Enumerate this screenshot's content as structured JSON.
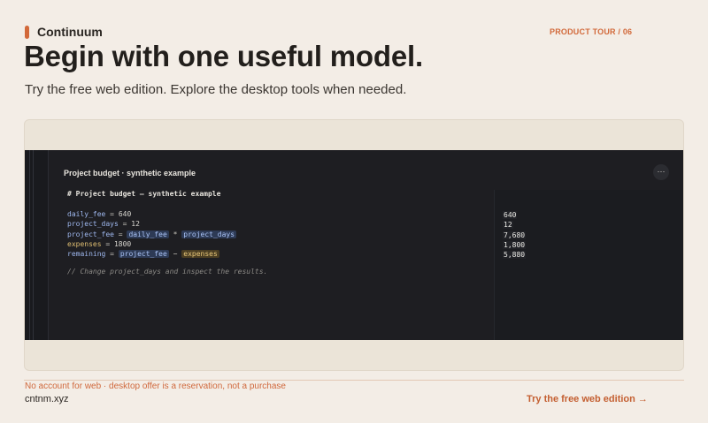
{
  "brand": {
    "name": "Continuum",
    "accent": "#d2693a"
  },
  "tour_label": "PRODUCT TOUR / 06",
  "headline": "Begin with one useful model.",
  "subhead": "Try the free web edition. Explore the desktop tools when needed.",
  "editor": {
    "title": "Project budget · synthetic example",
    "menu_label": "···",
    "heading": "# Project budget — synthetic example",
    "lines": [
      {
        "name": "daily_fee",
        "op": " = ",
        "value": "640"
      },
      {
        "name": "project_days",
        "op": " = ",
        "value": "12"
      },
      {
        "name": "project_fee",
        "op": " = ",
        "a": "daily_fee",
        "op2": " * ",
        "b": "project_days"
      },
      {
        "name": "expenses",
        "op": " = ",
        "value": "1800"
      },
      {
        "name": "remaining",
        "op": " = ",
        "a": "project_fee",
        "op2": " − ",
        "b": "expenses"
      }
    ],
    "comment": "// Change project_days and inspect the results.",
    "results": [
      "640",
      "12",
      "7,680",
      "1,800",
      "5,880"
    ]
  },
  "footer": {
    "disclaimer": "No account for web · desktop offer is a reservation, not a purchase",
    "domain": "cntnm.xyz",
    "cta": "Try the free web edition →"
  }
}
